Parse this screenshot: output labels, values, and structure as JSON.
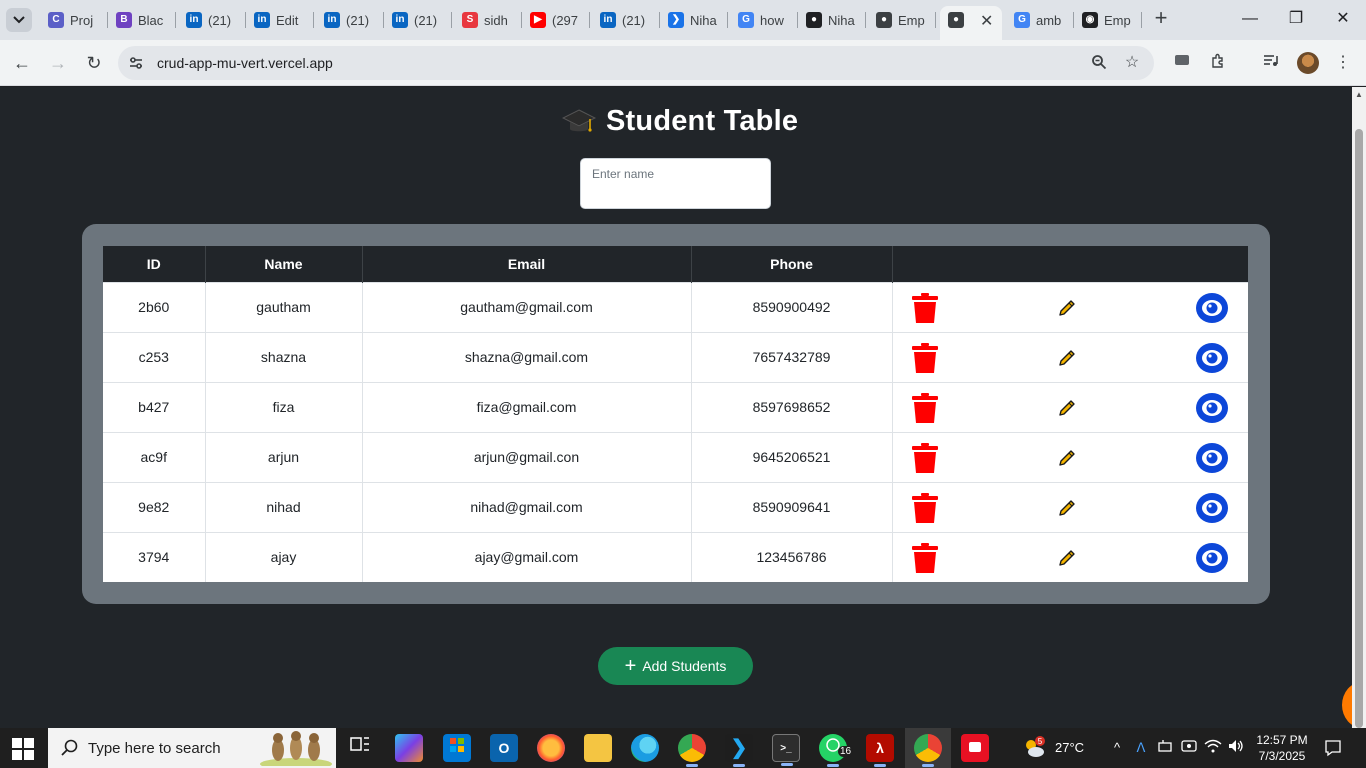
{
  "browser": {
    "tabs": [
      {
        "title": "Proj",
        "icon": "copilot-icon",
        "color": "#5b5fc7"
      },
      {
        "title": "Blac",
        "icon": "blackbox-icon",
        "color": "#6f42c1"
      },
      {
        "title": "(21)",
        "icon": "linkedin-icon",
        "color": "#0a66c2"
      },
      {
        "title": "Edit",
        "icon": "linkedin-icon",
        "color": "#0a66c2"
      },
      {
        "title": "(21)",
        "icon": "linkedin-icon",
        "color": "#0a66c2"
      },
      {
        "title": "(21)",
        "icon": "linkedin-icon",
        "color": "#0a66c2"
      },
      {
        "title": "sidh",
        "icon": "scaler-icon",
        "color": "#e8373f"
      },
      {
        "title": "(297",
        "icon": "youtube-icon",
        "color": "#ff0000"
      },
      {
        "title": "(21)",
        "icon": "linkedin-icon",
        "color": "#0a66c2"
      },
      {
        "title": "Niha",
        "icon": "vercel-icon",
        "color": "#1a73e8"
      },
      {
        "title": "how",
        "icon": "google-icon",
        "color": "#4285f4"
      },
      {
        "title": "Niha",
        "icon": "github-icon",
        "color": "#202124"
      },
      {
        "title": "Emp",
        "icon": "globe-icon",
        "color": "#3c4043"
      },
      {
        "title": "",
        "icon": "globe-icon",
        "color": "#3c4043",
        "active": true
      },
      {
        "title": "amb",
        "icon": "google-icon",
        "color": "#4285f4"
      },
      {
        "title": "Emp",
        "icon": "chatgpt-icon",
        "color": "#202124"
      }
    ],
    "url": "crud-app-mu-vert.vercel.app"
  },
  "page": {
    "title": "Student Table",
    "search_placeholder": "Enter name",
    "columns": [
      "ID",
      "Name",
      "Email",
      "Phone",
      ""
    ],
    "rows": [
      {
        "id": "2b60",
        "name": "gautham",
        "email": "gautham@gmail.com",
        "phone": "8590900492"
      },
      {
        "id": "c253",
        "name": "shazna",
        "email": "shazna@gmail.com",
        "phone": "7657432789"
      },
      {
        "id": "b427",
        "name": "fiza",
        "email": "fiza@gmail.com",
        "phone": "8597698652"
      },
      {
        "id": "ac9f",
        "name": "arjun",
        "email": "arjun@gmail.con",
        "phone": "9645206521"
      },
      {
        "id": "9e82",
        "name": "nihad",
        "email": "nihad@gmail.com",
        "phone": "8590909641"
      },
      {
        "id": "3794",
        "name": "ajay",
        "email": "ajay@gmail.com",
        "phone": "123456786"
      }
    ],
    "add_button_label": "Add Students",
    "colors": {
      "background": "#212529",
      "card": "#6c757d",
      "delete": "#ff0000",
      "view": "#0d47d9",
      "add": "#198754"
    }
  },
  "taskbar": {
    "search_placeholder": "Type here to search",
    "weather_badge": "5",
    "temperature": "27°C",
    "whatsapp_badge": "16",
    "time": "12:57 PM",
    "date": "7/3/2025"
  }
}
